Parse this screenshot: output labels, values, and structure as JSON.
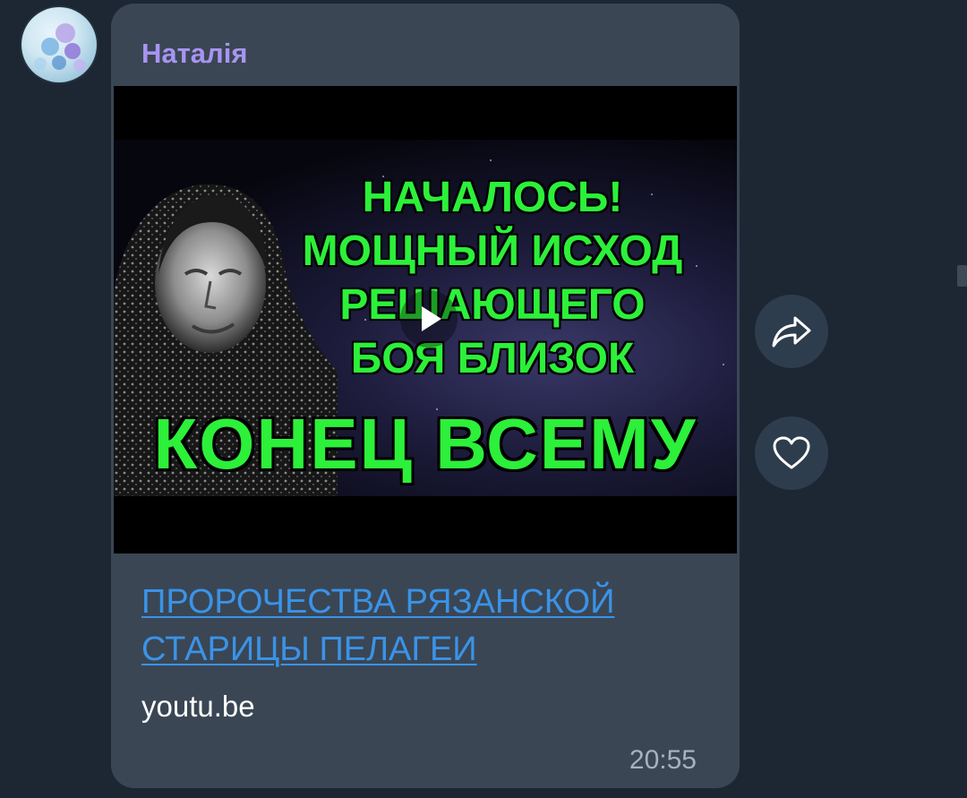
{
  "message": {
    "sender_name": "Наталія",
    "video_headline_lines": [
      "НАЧАЛОСЬ!",
      "МОЩНЫЙ ИСХОД",
      "РЕШАЮЩЕГО",
      "БОЯ БЛИЗОК"
    ],
    "video_big_line": "КОНЕЦ ВСЕМУ",
    "link_title": "ПРОРОЧЕСТВА РЯЗАНСКОЙ СТАРИЦЫ ПЕЛАГЕИ",
    "site": "youtu.be",
    "time": "20:55"
  },
  "actions": {
    "share_icon": "share-arrow-icon",
    "like_icon": "heart-icon"
  },
  "colors": {
    "background": "#1c2733",
    "bubble": "#3a4654",
    "sender": "#a894f0",
    "link": "#3a93e8",
    "headline_green": "#2cf03a"
  }
}
